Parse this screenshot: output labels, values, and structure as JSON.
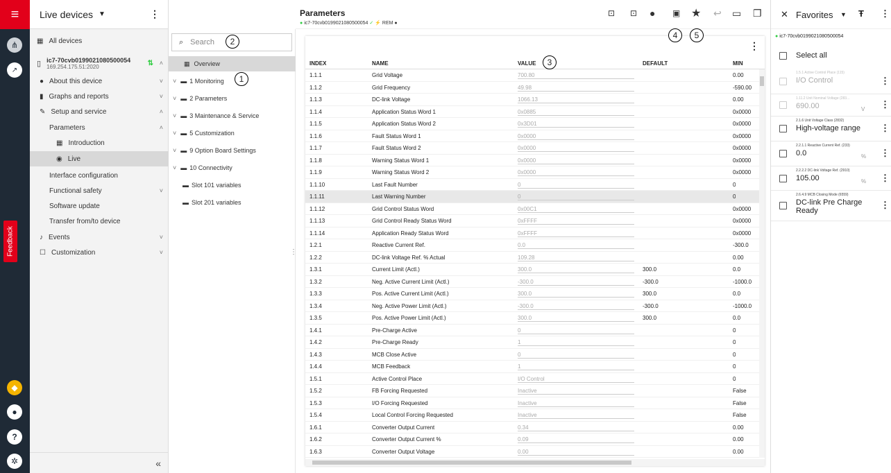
{
  "nav": {
    "title": "Live devices",
    "all_devices": "All devices",
    "device_name": "ic7-70cvb0199021080500054",
    "device_ip": "169.254.175.51:2020",
    "items": [
      {
        "label": "About this device"
      },
      {
        "label": "Graphs and reports"
      },
      {
        "label": "Setup and service"
      },
      {
        "label": "Parameters"
      },
      {
        "label": "Introduction"
      },
      {
        "label": "Live"
      },
      {
        "label": "Interface configuration"
      },
      {
        "label": "Functional safety"
      },
      {
        "label": "Software update"
      },
      {
        "label": "Transfer from/to device"
      },
      {
        "label": "Events"
      },
      {
        "label": "Customization"
      }
    ],
    "feedback": "Feedback"
  },
  "header": {
    "title": "Parameters",
    "device": "ic7-70cvb0199021080500054",
    "rem": "REM"
  },
  "tree": {
    "search_placeholder": "Search",
    "items": [
      {
        "label": "Overview"
      },
      {
        "label": "1 Monitoring"
      },
      {
        "label": "2 Parameters"
      },
      {
        "label": "3 Maintenance & Service"
      },
      {
        "label": "5 Customization"
      },
      {
        "label": "9 Option Board Settings"
      },
      {
        "label": "10 Connectivity"
      },
      {
        "label": "Slot 101 variables"
      },
      {
        "label": "Slot 201 variables"
      }
    ]
  },
  "table": {
    "columns": [
      "INDEX",
      "NAME",
      "VALUE",
      "DEFAULT",
      "MIN"
    ],
    "rows": [
      [
        "1.1.1",
        "Grid Voltage",
        "700.80",
        "",
        "0.00"
      ],
      [
        "1.1.2",
        "Grid Frequency",
        "49.98",
        "",
        "-590.00"
      ],
      [
        "1.1.3",
        "DC-link Voltage",
        "1066.13",
        "",
        "0.00"
      ],
      [
        "1.1.4",
        "Application Status Word 1",
        "0x0885",
        "",
        "0x0000"
      ],
      [
        "1.1.5",
        "Application Status Word 2",
        "0x3D01",
        "",
        "0x0000"
      ],
      [
        "1.1.6",
        "Fault Status Word 1",
        "0x0000",
        "",
        "0x0000"
      ],
      [
        "1.1.7",
        "Fault Status Word 2",
        "0x0000",
        "",
        "0x0000"
      ],
      [
        "1.1.8",
        "Warning Status Word 1",
        "0x0000",
        "",
        "0x0000"
      ],
      [
        "1.1.9",
        "Warning Status Word 2",
        "0x0000",
        "",
        "0x0000"
      ],
      [
        "1.1.10",
        "Last Fault Number",
        "0",
        "",
        "0"
      ],
      [
        "1.1.11",
        "Last Warning Number",
        "0",
        "",
        "0"
      ],
      [
        "1.1.12",
        "Grid Control Status Word",
        "0x00C1",
        "",
        "0x0000"
      ],
      [
        "1.1.13",
        "Grid Control Ready Status Word",
        "0xFFFF",
        "",
        "0x0000"
      ],
      [
        "1.1.14",
        "Application Ready Status Word",
        "0xFFFF",
        "",
        "0x0000"
      ],
      [
        "1.2.1",
        "Reactive Current Ref.",
        "0.0",
        "",
        "-300.0"
      ],
      [
        "1.2.2",
        "DC-link Voltage Ref. % Actual",
        "109.28",
        "",
        "0.00"
      ],
      [
        "1.3.1",
        "Current Limit (Actl.)",
        "300.0",
        "300.0",
        "0.0"
      ],
      [
        "1.3.2",
        "Neg. Active Current Limit (Actl.)",
        "-300.0",
        "-300.0",
        "-1000.0"
      ],
      [
        "1.3.3",
        "Pos. Active Current Limit (Actl.)",
        "300.0",
        "300.0",
        "0.0"
      ],
      [
        "1.3.4",
        "Neg. Active Power Limit (Actl.)",
        "-300.0",
        "-300.0",
        "-1000.0"
      ],
      [
        "1.3.5",
        "Pos. Active Power Limit (Actl.)",
        "300.0",
        "300.0",
        "0.0"
      ],
      [
        "1.4.1",
        "Pre-Charge Active",
        "0",
        "",
        "0"
      ],
      [
        "1.4.2",
        "Pre-Charge Ready",
        "1",
        "",
        "0"
      ],
      [
        "1.4.3",
        "MCB Close Active",
        "0",
        "",
        "0"
      ],
      [
        "1.4.4",
        "MCB Feedback",
        "1",
        "",
        "0"
      ],
      [
        "1.5.1",
        "Active Control Place",
        "I/O Control",
        "",
        "0"
      ],
      [
        "1.5.2",
        "FB Forcing Requested",
        "Inactive",
        "",
        "False"
      ],
      [
        "1.5.3",
        "I/O Forcing Requested",
        "Inactive",
        "",
        "False"
      ],
      [
        "1.5.4",
        "Local Control Forcing Requested",
        "Inactive",
        "",
        "False"
      ],
      [
        "1.6.1",
        "Converter Output Current",
        "0.34",
        "",
        "0.00"
      ],
      [
        "1.6.2",
        "Converter Output Current %",
        "0.09",
        "",
        "0.00"
      ],
      [
        "1.6.3",
        "Converter Output Voltage",
        "0.00",
        "",
        "0.00"
      ]
    ]
  },
  "favorites": {
    "title": "Favorites",
    "device": "ic7-70cvb0199021080500054",
    "select_all": "Select all",
    "items": [
      {
        "small": "1.5.1 Active Control Place (115)",
        "value": "I/O Control",
        "unit": ""
      },
      {
        "small": "1.11.2 Unit Nominal Voltage (283...",
        "value": "690.00",
        "unit": "V"
      },
      {
        "small": "2.1.6 Unit Voltage Class (2832)",
        "value": "High-voltage range",
        "unit": ""
      },
      {
        "small": "2.2.1.1 Reactive Current Ref. (233)",
        "value": "0.0",
        "unit": "%"
      },
      {
        "small": "2.2.2.2 DC-link Voltage Ref. (2910)",
        "value": "105.00",
        "unit": "%"
      },
      {
        "small": "2.6.4.9 MCB Closing Mode (6559)",
        "value": "DC-link Pre Charge Ready",
        "unit": ""
      }
    ]
  },
  "callouts": [
    "1",
    "2",
    "3",
    "4",
    "5"
  ],
  "colors": {
    "brand_red": "#e2001a",
    "rail_dark": "#1f2a36",
    "online_green": "#2ecc40"
  }
}
